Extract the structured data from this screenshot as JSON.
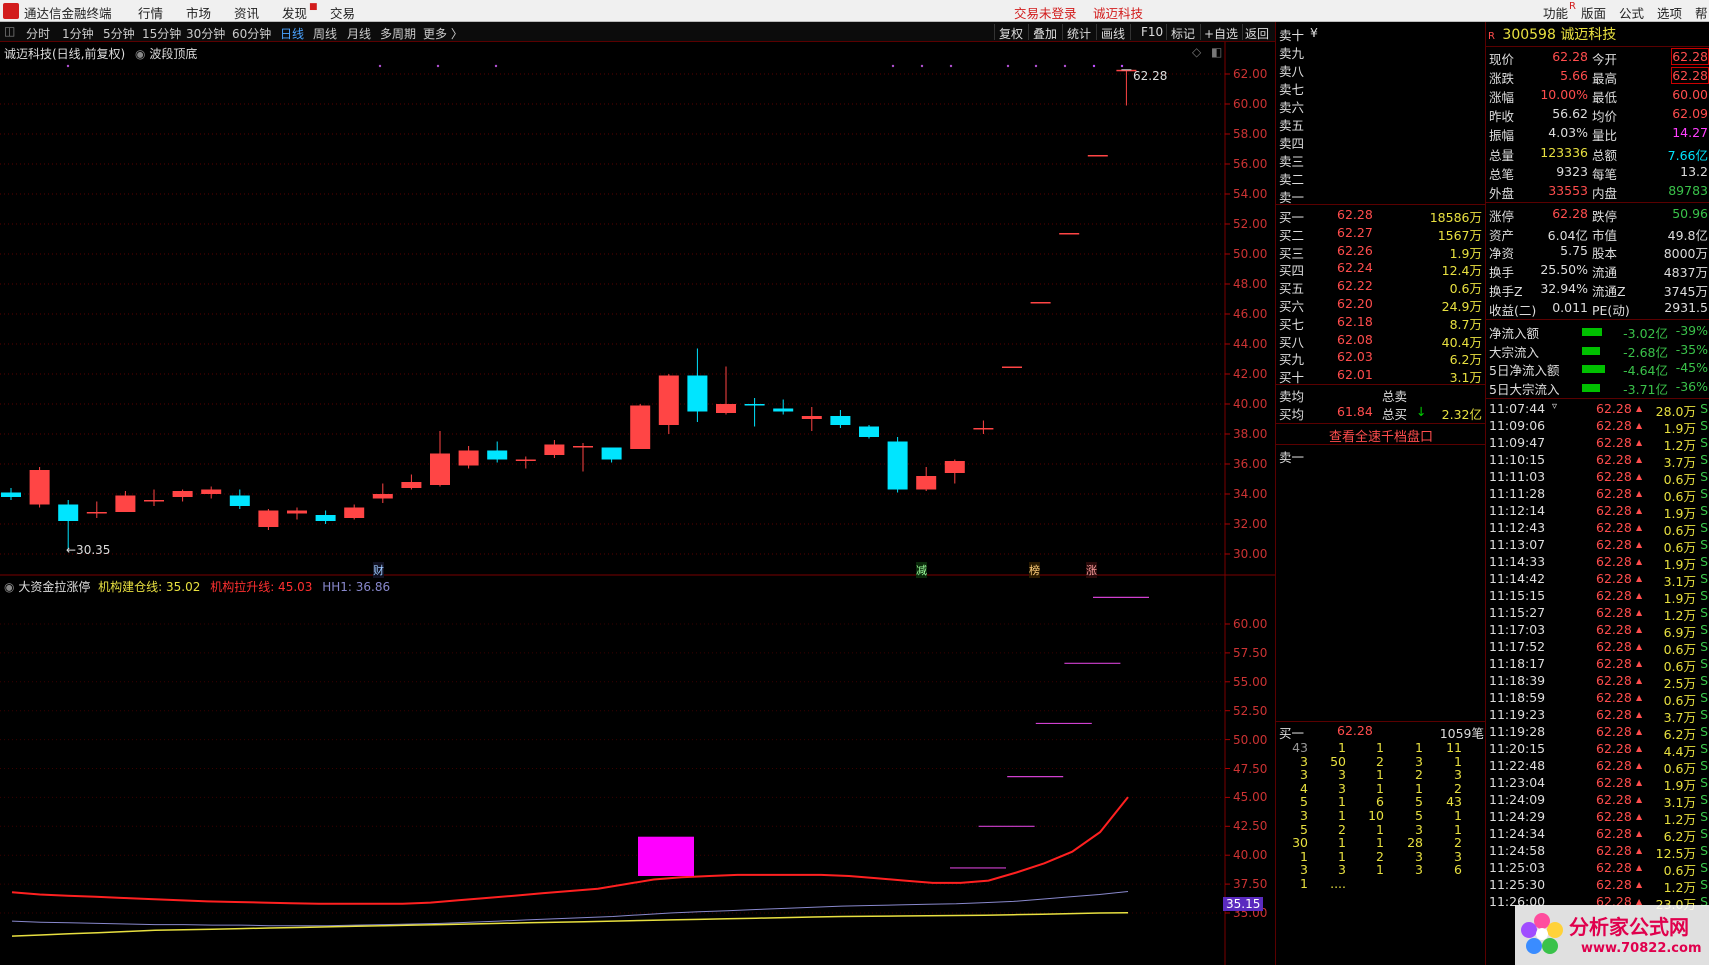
{
  "menubar": {
    "app_title": "通达信金融终端",
    "items": [
      "行情",
      "市场",
      "资讯",
      "发现",
      "交易"
    ],
    "status_login": "交易未登录",
    "status_stock": "诚迈科技",
    "right_items": [
      "功能",
      "版面",
      "公式",
      "选项",
      "帮"
    ]
  },
  "periodbar": {
    "periods": [
      "分时",
      "1分钟",
      "5分钟",
      "15分钟",
      "30分钟",
      "60分钟",
      "日线",
      "周线",
      "月线",
      "多周期",
      "更多 〉"
    ],
    "active": "日线",
    "tools": [
      "复权",
      "叠加",
      "统计",
      "画线",
      "F10",
      "标记",
      "+自选",
      "返回"
    ]
  },
  "chart": {
    "title": "诚迈科技(日线,前复权)",
    "indicator_name": "波段顶底",
    "price_axis": [
      "62.00",
      "60.00",
      "58.00",
      "56.00",
      "54.00",
      "52.00",
      "50.00",
      "48.00",
      "46.00",
      "44.00",
      "42.00",
      "40.00",
      "38.00",
      "36.00",
      "34.00",
      "32.00",
      "30.00"
    ],
    "high_label": "62.28",
    "low_label": "←30.35",
    "markers": [
      "财",
      "减",
      "榜",
      "涨"
    ],
    "colors": {
      "up": "#ff4545",
      "down": "#00e5ff",
      "grid": "#5a0000"
    }
  },
  "indicator": {
    "name": "大资金拉涨停",
    "line1_label": "机构建仓线: 35.02",
    "line2_label": "机构拉升线: 45.03",
    "line3_label": "HH1: 36.86",
    "axis": [
      "60.00",
      "57.50",
      "55.00",
      "52.50",
      "50.00",
      "47.50",
      "45.00",
      "42.50",
      "40.00",
      "37.50",
      "35.00"
    ],
    "current_tag": "35.15",
    "colors": {
      "line1": "#e8e040",
      "line2": "#ff2020",
      "line3": "#8888cc",
      "box": "#ff00ff"
    }
  },
  "chart_data": {
    "type": "candlestick",
    "candles": [
      [
        34.1,
        33.8,
        34.4,
        33.6
      ],
      [
        33.3,
        35.6,
        35.8,
        33.1
      ],
      [
        33.3,
        32.2,
        33.6,
        30.35
      ],
      [
        32.7,
        32.8,
        33.5,
        32.4
      ],
      [
        32.8,
        33.9,
        34.2,
        32.8
      ],
      [
        33.5,
        33.6,
        34.3,
        33.2
      ],
      [
        33.8,
        34.2,
        34.3,
        33.5
      ],
      [
        34.0,
        34.3,
        34.5,
        33.7
      ],
      [
        33.9,
        33.2,
        34.3,
        33.0
      ],
      [
        31.8,
        32.9,
        33.0,
        31.6
      ],
      [
        32.7,
        32.9,
        33.1,
        32.3
      ],
      [
        32.6,
        32.2,
        32.9,
        32.0
      ],
      [
        32.4,
        33.1,
        33.3,
        32.3
      ],
      [
        33.7,
        34.0,
        34.7,
        33.4
      ],
      [
        34.4,
        34.8,
        35.3,
        34.3
      ],
      [
        34.6,
        36.7,
        38.2,
        34.5
      ],
      [
        35.9,
        36.9,
        37.2,
        35.7
      ],
      [
        36.9,
        36.3,
        37.5,
        36.1
      ],
      [
        36.2,
        36.3,
        36.5,
        35.7
      ],
      [
        36.6,
        37.3,
        37.6,
        36.4
      ],
      [
        37.1,
        37.2,
        37.4,
        35.5
      ],
      [
        37.1,
        36.3,
        37.1,
        36.1
      ],
      [
        37.0,
        39.9,
        40.0,
        37.0
      ],
      [
        38.6,
        41.9,
        42.0,
        38.0
      ],
      [
        41.9,
        39.5,
        43.7,
        38.8
      ],
      [
        39.4,
        40.0,
        42.5,
        39.3
      ],
      [
        40.0,
        39.9,
        40.4,
        38.5
      ],
      [
        39.7,
        39.5,
        40.3,
        39.3
      ],
      [
        39.0,
        39.2,
        39.8,
        38.2
      ],
      [
        39.2,
        38.6,
        39.6,
        38.4
      ],
      [
        38.5,
        37.8,
        38.6,
        37.7
      ],
      [
        37.5,
        34.3,
        37.8,
        34.1
      ],
      [
        34.3,
        35.2,
        35.8,
        34.2
      ],
      [
        35.4,
        36.2,
        36.3,
        34.7
      ],
      [
        38.4,
        38.4,
        38.9,
        38.0
      ],
      [
        42.5,
        42.5,
        42.5,
        42.5
      ],
      [
        46.8,
        46.8,
        46.8,
        46.8
      ],
      [
        51.4,
        51.4,
        51.4,
        51.4
      ],
      [
        56.6,
        56.6,
        56.6,
        56.6
      ],
      [
        62.28,
        62.28,
        62.28,
        59.9
      ]
    ],
    "indicator_lines": {
      "机构建仓线": [
        33.0,
        33.1,
        33.2,
        33.3,
        33.4,
        33.5,
        33.55,
        33.6,
        33.65,
        33.7,
        33.75,
        33.8,
        33.85,
        33.9,
        33.95,
        34.0,
        34.05,
        34.1,
        34.15,
        34.2,
        34.25,
        34.3,
        34.35,
        34.4,
        34.45,
        34.5,
        34.55,
        34.6,
        34.65,
        34.7,
        34.72,
        34.74,
        34.76,
        34.78,
        34.8,
        34.85,
        34.9,
        34.95,
        35.0,
        35.02
      ],
      "机构拉升线": [
        36.8,
        36.6,
        36.5,
        36.4,
        36.3,
        36.2,
        36.1,
        36.0,
        35.95,
        35.9,
        35.85,
        35.8,
        35.8,
        35.8,
        35.8,
        35.9,
        36.1,
        36.3,
        36.5,
        36.7,
        36.9,
        37.1,
        37.5,
        37.9,
        38.1,
        38.2,
        38.3,
        38.3,
        38.3,
        38.3,
        38.2,
        38.0,
        37.8,
        37.6,
        37.6,
        37.8,
        38.5,
        39.3,
        40.3,
        42.0,
        45.03
      ],
      "HH1": [
        34.3,
        34.2,
        34.15,
        34.1,
        34.05,
        34.0,
        34.0,
        33.95,
        33.95,
        33.9,
        33.9,
        33.9,
        33.95,
        34.0,
        34.05,
        34.1,
        34.2,
        34.3,
        34.4,
        34.5,
        34.6,
        34.7,
        34.85,
        35.0,
        35.1,
        35.2,
        35.3,
        35.4,
        35.5,
        35.6,
        35.65,
        35.7,
        35.75,
        35.8,
        35.9,
        36.0,
        36.2,
        36.4,
        36.6,
        36.86
      ],
      "steps": [
        38.9,
        42.5,
        46.8,
        51.4,
        56.6,
        62.3
      ]
    }
  },
  "orderbook": {
    "header_label": "卖十",
    "header_unit": "¥",
    "sells": [
      "卖九",
      "卖八",
      "卖七",
      "卖六",
      "卖五",
      "卖四",
      "卖三",
      "卖二",
      "卖一"
    ],
    "buys": [
      {
        "label": "买一",
        "price": "62.28",
        "vol": "18586万"
      },
      {
        "label": "买二",
        "price": "62.27",
        "vol": "1567万"
      },
      {
        "label": "买三",
        "price": "62.26",
        "vol": "1.9万"
      },
      {
        "label": "买四",
        "price": "62.24",
        "vol": "12.4万"
      },
      {
        "label": "买五",
        "price": "62.22",
        "vol": "0.6万"
      },
      {
        "label": "买六",
        "price": "62.20",
        "vol": "24.9万"
      },
      {
        "label": "买七",
        "price": "62.18",
        "vol": "8.7万"
      },
      {
        "label": "买八",
        "price": "62.08",
        "vol": "40.4万"
      },
      {
        "label": "买九",
        "price": "62.03",
        "vol": "6.2万"
      },
      {
        "label": "买十",
        "price": "62.01",
        "vol": "3.1万"
      }
    ],
    "avg_sell_label": "卖均",
    "total_sell_label": "总卖",
    "avg_buy_label": "买均",
    "avg_buy_price": "61.84",
    "total_buy_label": "总买",
    "total_buy_val": "2.32亿",
    "link_text": "查看全速千档盘口",
    "queue_sell_label": "卖一",
    "queue_buy_label": "买一",
    "queue_buy_price": "62.28",
    "queue_buy_count": "1059笔",
    "queue_grid": [
      [
        "43",
        "1",
        "1",
        "1",
        "11"
      ],
      [
        "3",
        "50",
        "2",
        "3",
        "1"
      ],
      [
        "3",
        "3",
        "1",
        "2",
        "3"
      ],
      [
        "4",
        "3",
        "1",
        "1",
        "2"
      ],
      [
        "5",
        "1",
        "6",
        "5",
        "43"
      ],
      [
        "3",
        "1",
        "10",
        "5",
        "1"
      ],
      [
        "5",
        "2",
        "1",
        "3",
        "1"
      ],
      [
        "30",
        "1",
        "1",
        "28",
        "2"
      ],
      [
        "1",
        "1",
        "2",
        "3",
        "3"
      ],
      [
        "3",
        "3",
        "1",
        "3",
        "6"
      ],
      [
        "1",
        "....",
        "",
        "",
        ""
      ]
    ]
  },
  "quote": {
    "code": "300598",
    "name": "诚迈科技",
    "rows": [
      [
        "现价",
        "62.28",
        "今开",
        "62.28"
      ],
      [
        "涨跌",
        "5.66",
        "最高",
        "62.28"
      ],
      [
        "涨幅",
        "10.00%",
        "最低",
        "60.00"
      ],
      [
        "昨收",
        "56.62",
        "均价",
        "62.09"
      ],
      [
        "振幅",
        "4.03%",
        "量比",
        "14.27"
      ],
      [
        "总量",
        "123336",
        "总额",
        "7.66亿"
      ],
      [
        "总笔",
        "9323",
        "每笔",
        "13.2"
      ],
      [
        "外盘",
        "33553",
        "内盘",
        "89783"
      ]
    ],
    "rows2": [
      [
        "涨停",
        "62.28",
        "跌停",
        "50.96"
      ],
      [
        "资产",
        "6.04亿",
        "市值",
        "49.8亿"
      ],
      [
        "净资",
        "5.75",
        "股本",
        "8000万"
      ],
      [
        "换手",
        "25.50%",
        "流通",
        "4837万"
      ],
      [
        "换手Z",
        "32.94%",
        "流通Z",
        "3745万"
      ],
      [
        "收益(二)",
        "0.011",
        "PE(动)",
        "2931.5"
      ]
    ],
    "flows": [
      {
        "label": "净流入额",
        "value": "-3.02亿",
        "pct": "-39%",
        "bar": 0.39
      },
      {
        "label": "大宗流入",
        "value": "-2.68亿",
        "pct": "-35%",
        "bar": 0.35
      },
      {
        "label": "5日净流入额",
        "value": "-4.64亿",
        "pct": "-45%",
        "bar": 0.45
      },
      {
        "label": "5日大宗流入",
        "value": "-3.71亿",
        "pct": "-36%",
        "bar": 0.36
      }
    ],
    "ticks": [
      [
        "11:07:44",
        "62.28",
        "28.0万",
        "S"
      ],
      [
        "11:09:06",
        "62.28",
        "1.9万",
        "S"
      ],
      [
        "11:09:47",
        "62.28",
        "1.2万",
        "S"
      ],
      [
        "11:10:15",
        "62.28",
        "3.7万",
        "S"
      ],
      [
        "11:11:03",
        "62.28",
        "0.6万",
        "S"
      ],
      [
        "11:11:28",
        "62.28",
        "0.6万",
        "S"
      ],
      [
        "11:12:14",
        "62.28",
        "1.9万",
        "S"
      ],
      [
        "11:12:43",
        "62.28",
        "0.6万",
        "S"
      ],
      [
        "11:13:07",
        "62.28",
        "0.6万",
        "S"
      ],
      [
        "11:14:33",
        "62.28",
        "1.9万",
        "S"
      ],
      [
        "11:14:42",
        "62.28",
        "3.1万",
        "S"
      ],
      [
        "11:15:15",
        "62.28",
        "1.9万",
        "S"
      ],
      [
        "11:15:27",
        "62.28",
        "1.2万",
        "S"
      ],
      [
        "11:17:03",
        "62.28",
        "6.9万",
        "S"
      ],
      [
        "11:17:52",
        "62.28",
        "0.6万",
        "S"
      ],
      [
        "11:18:17",
        "62.28",
        "0.6万",
        "S"
      ],
      [
        "11:18:39",
        "62.28",
        "2.5万",
        "S"
      ],
      [
        "11:18:59",
        "62.28",
        "0.6万",
        "S"
      ],
      [
        "11:19:23",
        "62.28",
        "3.7万",
        "S"
      ],
      [
        "11:19:28",
        "62.28",
        "6.2万",
        "S"
      ],
      [
        "11:20:15",
        "62.28",
        "4.4万",
        "S"
      ],
      [
        "11:22:48",
        "62.28",
        "0.6万",
        "S"
      ],
      [
        "11:23:04",
        "62.28",
        "1.9万",
        "S"
      ],
      [
        "11:24:09",
        "62.28",
        "3.1万",
        "S"
      ],
      [
        "11:24:29",
        "62.28",
        "1.2万",
        "S"
      ],
      [
        "11:24:34",
        "62.28",
        "6.2万",
        "S"
      ],
      [
        "11:24:58",
        "62.28",
        "12.5万",
        "S"
      ],
      [
        "11:25:03",
        "62.28",
        "0.6万",
        "S"
      ],
      [
        "11:25:30",
        "62.28",
        "1.2万",
        "S"
      ],
      [
        "11:26:00",
        "62.28",
        "23.0万",
        "S"
      ]
    ]
  },
  "watermark": {
    "title": "分析家公式网",
    "url": "www.70822.com"
  }
}
